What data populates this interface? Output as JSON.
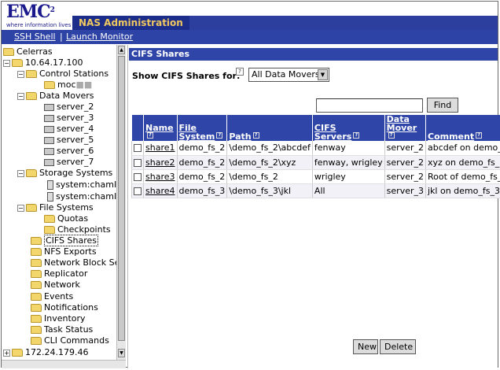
{
  "header": {
    "logo_text": "EMC",
    "logo_sup": "2",
    "tagline": "where information lives",
    "app_title": "NAS Administration"
  },
  "toolbar": {
    "ssh_shell": "SSH Shell",
    "launch_monitor": "Launch Monitor"
  },
  "tree": {
    "root": "Celerras",
    "host1": "10.64.17.100",
    "control_stations": "Control Stations",
    "control_station_item": "moc",
    "data_movers": "Data Movers",
    "servers": [
      "server_2",
      "server_3",
      "server_4",
      "server_5",
      "server_6",
      "server_7"
    ],
    "storage_systems": "Storage Systems",
    "storage_items": [
      "system:chamI",
      "system:chamI"
    ],
    "file_systems": "File Systems",
    "quotas": "Quotas",
    "checkpoints": "Checkpoints",
    "cifs_shares": "CIFS Shares",
    "nfs_exports": "NFS Exports",
    "network_block": "Network Block Se",
    "replicator": "Replicator",
    "network": "Network",
    "events": "Events",
    "notifications": "Notifications",
    "inventory": "Inventory",
    "task_status": "Task Status",
    "cli_commands": "CLI Commands",
    "host2": "172.24.179.46"
  },
  "panel": {
    "title": "CIFS Shares",
    "show_for_label": "Show CIFS Shares for:",
    "mover_select_value": "All Data Movers",
    "find_value": "",
    "find_button": "Find",
    "new_button": "New",
    "delete_button": "Delete"
  },
  "table": {
    "headers": {
      "name": "Name",
      "file_system_1": "File",
      "file_system_2": "System",
      "path": "Path",
      "cifs_servers_1": "CIFS",
      "cifs_servers_2": "Servers",
      "data_mover_1": "Data",
      "data_mover_2": "Mover",
      "comment": "Comment"
    },
    "rows": [
      {
        "name": "share1",
        "fs": "demo_fs_2",
        "path": "\\demo_fs_2\\abcdef",
        "servers": "fenway",
        "mover": "server_2",
        "comment": "abcdef on demo_"
      },
      {
        "name": "share2",
        "fs": "demo_fs_2",
        "path": "\\demo_fs_2\\xyz",
        "servers": "fenway, wrigley",
        "mover": "server_2",
        "comment": "xyz on demo_fs_"
      },
      {
        "name": "share3",
        "fs": "demo_fs_2",
        "path": "\\demo_fs_2",
        "servers": "wrigley",
        "mover": "server_2",
        "comment": "Root of demo_fs_"
      },
      {
        "name": "share4",
        "fs": "demo_fs_3",
        "path": "\\demo_fs_3\\jkl",
        "servers": "All",
        "mover": "server_3",
        "comment": "jkl on demo_fs_3"
      }
    ]
  }
}
